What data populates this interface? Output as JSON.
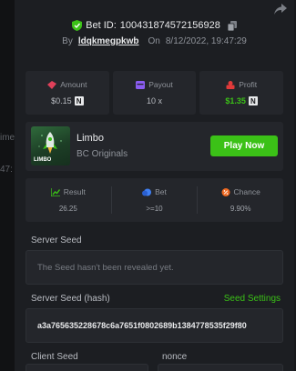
{
  "background": {
    "ghost_texts": [
      "ime",
      "47:"
    ]
  },
  "header": {
    "bet_id_label": "Bet ID:",
    "bet_id": "100431874572156928",
    "by_label": "By",
    "username": "ldqkmegpkwb",
    "on_label": "On",
    "date": "8/12/2022, 19:47:29"
  },
  "summary": {
    "amount": {
      "label": "Amount",
      "value": "$0.15",
      "coin": "N"
    },
    "payout": {
      "label": "Payout",
      "value": "10 x"
    },
    "profit": {
      "label": "Profit",
      "value": "$1.35",
      "coin": "N"
    }
  },
  "game": {
    "name": "Limbo",
    "provider": "BC Originals",
    "thumb_logo": "LIMBO",
    "play_label": "Play Now"
  },
  "result": {
    "result": {
      "label": "Result",
      "value": "26.25"
    },
    "bet": {
      "label": "Bet",
      "value": ">=10"
    },
    "chance": {
      "label": "Chance",
      "value": "9.90%"
    }
  },
  "seeds": {
    "server_seed_label": "Server Seed",
    "server_seed_value": "The Seed hasn't been revealed yet.",
    "server_hash_label": "Server Seed (hash)",
    "seed_settings_label": "Seed Settings",
    "server_hash_value": "a3a765635228678c6a7651f0802689b1384778535f29f80",
    "client_seed_label": "Client Seed",
    "nonce_label": "nonce"
  },
  "colors": {
    "accent_green": "#3bc117",
    "amount_icon": "#e0405a",
    "payout_icon": "#8a5cf0",
    "profit_icon": "#e03a3a",
    "result_icon": "#3bc117",
    "bet_icon": "#3f7ff3",
    "chance_icon": "#f06a22"
  }
}
